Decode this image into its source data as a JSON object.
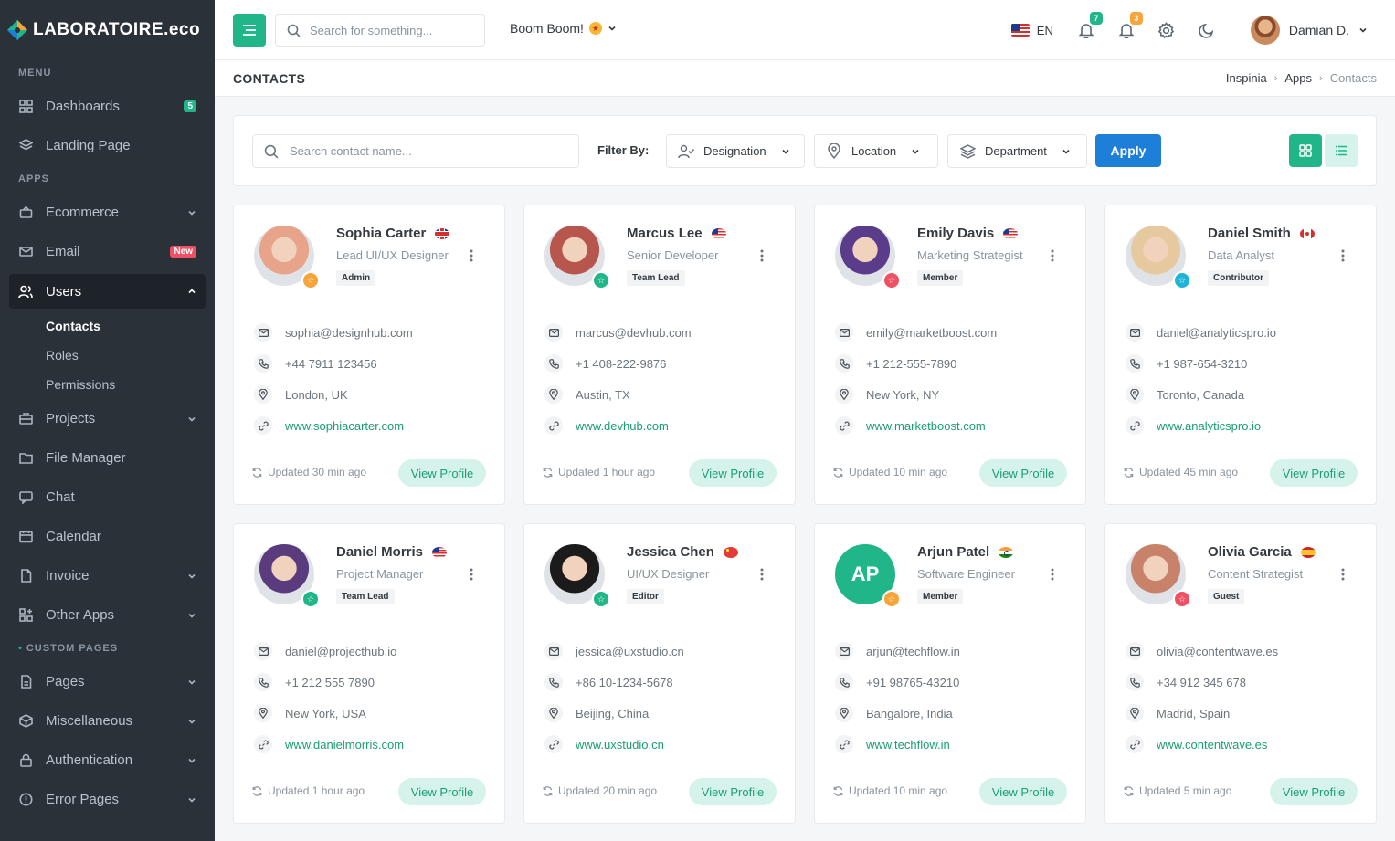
{
  "brand": {
    "name": "LABORATOIRE.eco"
  },
  "sidebar": {
    "menu_title": "MENU",
    "apps_title": "APPS",
    "custom_title": "CUSTOM PAGES",
    "dashboards": {
      "label": "Dashboards",
      "badge": "5"
    },
    "landing": {
      "label": "Landing Page"
    },
    "ecommerce": {
      "label": "Ecommerce"
    },
    "email": {
      "label": "Email",
      "badge": "New"
    },
    "users": {
      "label": "Users"
    },
    "users_sub": [
      "Contacts",
      "Roles",
      "Permissions"
    ],
    "projects": {
      "label": "Projects"
    },
    "file_manager": {
      "label": "File Manager"
    },
    "chat": {
      "label": "Chat"
    },
    "calendar": {
      "label": "Calendar"
    },
    "invoice": {
      "label": "Invoice"
    },
    "other_apps": {
      "label": "Other Apps"
    },
    "pages": {
      "label": "Pages"
    },
    "misc": {
      "label": "Miscellaneous"
    },
    "auth": {
      "label": "Authentication"
    },
    "errors": {
      "label": "Error Pages"
    }
  },
  "topbar": {
    "search_placeholder": "Search for something...",
    "workspace": "Boom Boom!",
    "lang": "EN",
    "notif_count_1": "7",
    "notif_count_2": "3",
    "user_name": "Damian D."
  },
  "page": {
    "title": "CONTACTS",
    "breadcrumbs": [
      "Inspinia",
      "Apps",
      "Contacts"
    ]
  },
  "filters": {
    "search_placeholder": "Search contact name...",
    "label": "Filter By:",
    "designation": "Designation",
    "location": "Location",
    "department": "Department",
    "apply": "Apply"
  },
  "colors": {
    "accent": "#21b68a",
    "primary": "#1e7fd9",
    "sidebar": "#2a3139"
  },
  "contacts": [
    {
      "name": "Sophia Carter",
      "flag": "uk",
      "role": "Lead UI/UX Designer",
      "tag": "Admin",
      "email": "sophia@designhub.com",
      "phone": "+44 7911 123456",
      "location": "London, UK",
      "website": "www.sophiacarter.com",
      "updated": "Updated 30 min ago",
      "badge_color": "#f7a43b",
      "avatar_color": "#e8a48a",
      "initials": "",
      "view": "View Profile"
    },
    {
      "name": "Marcus Lee",
      "flag": "us",
      "role": "Senior Developer",
      "tag": "Team Lead",
      "email": "marcus@devhub.com",
      "phone": "+1 408-222-9876",
      "location": "Austin, TX",
      "website": "www.devhub.com",
      "updated": "Updated 1 hour ago",
      "badge_color": "#21b68a",
      "avatar_color": "#b7564c",
      "initials": "",
      "view": "View Profile"
    },
    {
      "name": "Emily Davis",
      "flag": "us",
      "role": "Marketing Strategist",
      "tag": "Member",
      "email": "emily@marketboost.com",
      "phone": "+1 212-555-7890",
      "location": "New York, NY",
      "website": "www.marketboost.com",
      "updated": "Updated 10 min ago",
      "badge_color": "#ef5063",
      "avatar_color": "#5b3c8a",
      "initials": "",
      "view": "View Profile"
    },
    {
      "name": "Daniel Smith",
      "flag": "ca",
      "role": "Data Analyst",
      "tag": "Contributor",
      "email": "daniel@analyticspro.io",
      "phone": "+1 987-654-3210",
      "location": "Toronto, Canada",
      "website": "www.analyticspro.io",
      "updated": "Updated 45 min ago",
      "badge_color": "#1fb5d6",
      "avatar_color": "#e7c9a0",
      "initials": "",
      "view": "View Profile"
    },
    {
      "name": "Daniel Morris",
      "flag": "us",
      "role": "Project Manager",
      "tag": "Team Lead",
      "email": "daniel@projecthub.io",
      "phone": "+1 212 555 7890",
      "location": "New York, USA",
      "website": "www.danielmorris.com",
      "updated": "Updated 1 hour ago",
      "badge_color": "#21b68a",
      "avatar_color": "#5a3c7e",
      "initials": "",
      "view": "View Profile"
    },
    {
      "name": "Jessica Chen",
      "flag": "cn",
      "role": "UI/UX Designer",
      "tag": "Editor",
      "email": "jessica@uxstudio.cn",
      "phone": "+86 10-1234-5678",
      "location": "Beijing, China",
      "website": "www.uxstudio.cn",
      "updated": "Updated 20 min ago",
      "badge_color": "#21b68a",
      "avatar_color": "#1b1b1b",
      "initials": "",
      "view": "View Profile"
    },
    {
      "name": "Arjun Patel",
      "flag": "in",
      "role": "Software Engineer",
      "tag": "Member",
      "email": "arjun@techflow.in",
      "phone": "+91 98765-43210",
      "location": "Bangalore, India",
      "website": "www.techflow.in",
      "updated": "Updated 10 min ago",
      "badge_color": "#f7a43b",
      "avatar_color": "#21b68a",
      "initials": "AP",
      "view": "View Profile"
    },
    {
      "name": "Olivia Garcia",
      "flag": "es",
      "role": "Content Strategist",
      "tag": "Guest",
      "email": "olivia@contentwave.es",
      "phone": "+34 912 345 678",
      "location": "Madrid, Spain",
      "website": "www.contentwave.es",
      "updated": "Updated 5 min ago",
      "badge_color": "#ef5063",
      "avatar_color": "#c9826a",
      "initials": "",
      "view": "View Profile"
    }
  ]
}
